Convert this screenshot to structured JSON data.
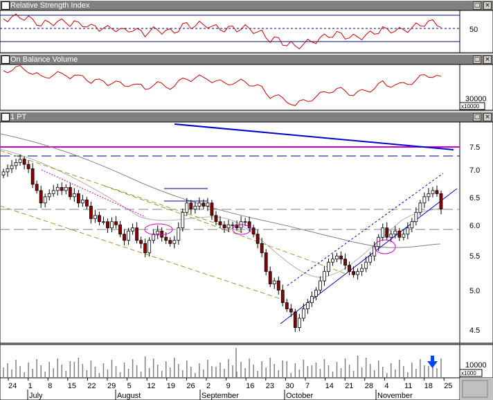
{
  "panels": {
    "rsi": {
      "title": "Relative Strength Index",
      "axis_label": "50"
    },
    "obv": {
      "title": "On Balance Volume",
      "axis_label": "30000",
      "multiplier": "x10000"
    },
    "price": {
      "title": "1 PT",
      "y_ticks": [
        "7.5",
        "7.0",
        "6.5",
        "6.0",
        "5.5",
        "5.0",
        "4.5"
      ]
    },
    "volume": {
      "axis_label": "10000",
      "multiplier": "x1000"
    }
  },
  "window_buttons": {
    "restore": "□",
    "close": "×"
  },
  "colors": {
    "background": "#ffffff",
    "indicator_line": "#cc0000",
    "candle_up": "#ffffff",
    "candle_down": "#8b0000",
    "trendline_blue": "#0000cc",
    "resistance_magenta": "#cc00cc",
    "channel_olive": "#999933",
    "moving_average": "#808080",
    "volume_bar": "#808080",
    "arrow": "#0044ff"
  },
  "x_axis": {
    "day_labels": [
      "24",
      "1",
      "8",
      "15",
      "22",
      "29",
      "5",
      "12",
      "19",
      "26",
      "2",
      "9",
      "16",
      "23",
      "30",
      "7",
      "14",
      "21",
      "28",
      "4",
      "11",
      "18",
      "25"
    ],
    "month_labels": [
      "July",
      "August",
      "September",
      "October",
      "November"
    ]
  },
  "chart_data": {
    "type": "candlestick",
    "title": "1 PT",
    "ylim": [
      4.35,
      7.9
    ],
    "y_ticks": [
      4.5,
      5.0,
      5.5,
      6.0,
      6.5,
      7.0,
      7.5
    ],
    "close": [
      7.1,
      7.15,
      7.2,
      7.25,
      7.3,
      7.22,
      7.15,
      6.9,
      6.8,
      6.6,
      6.7,
      6.75,
      6.8,
      6.85,
      6.8,
      6.85,
      6.7,
      6.75,
      6.6,
      6.65,
      6.55,
      6.35,
      6.4,
      6.3,
      6.3,
      6.2,
      6.3,
      6.25,
      6.1,
      6.0,
      6.15,
      6.2,
      6.0,
      5.95,
      5.8,
      6.0,
      6.1,
      6.15,
      6.05,
      6.0,
      5.95,
      6.0,
      6.2,
      6.45,
      6.6,
      6.5,
      6.55,
      6.6,
      6.55,
      6.6,
      6.4,
      6.3,
      6.25,
      6.2,
      6.25,
      6.25,
      6.2,
      6.3,
      6.3,
      6.2,
      6.1,
      5.95,
      5.8,
      5.5,
      5.3,
      5.35,
      5.2,
      5.0,
      4.9,
      4.85,
      4.6,
      4.75,
      4.9,
      5.0,
      5.1,
      5.2,
      5.35,
      5.5,
      5.65,
      5.7,
      5.75,
      5.7,
      5.6,
      5.5,
      5.45,
      5.5,
      5.55,
      5.65,
      5.75,
      5.9,
      6.05,
      6.2,
      6.05,
      6.1,
      6.15,
      6.05,
      6.1,
      6.2,
      6.3,
      6.45,
      6.6,
      6.7,
      6.75,
      6.8,
      6.75,
      6.5
    ],
    "overlays": [
      "Relative Strength Index",
      "On Balance Volume",
      "Volume"
    ]
  }
}
